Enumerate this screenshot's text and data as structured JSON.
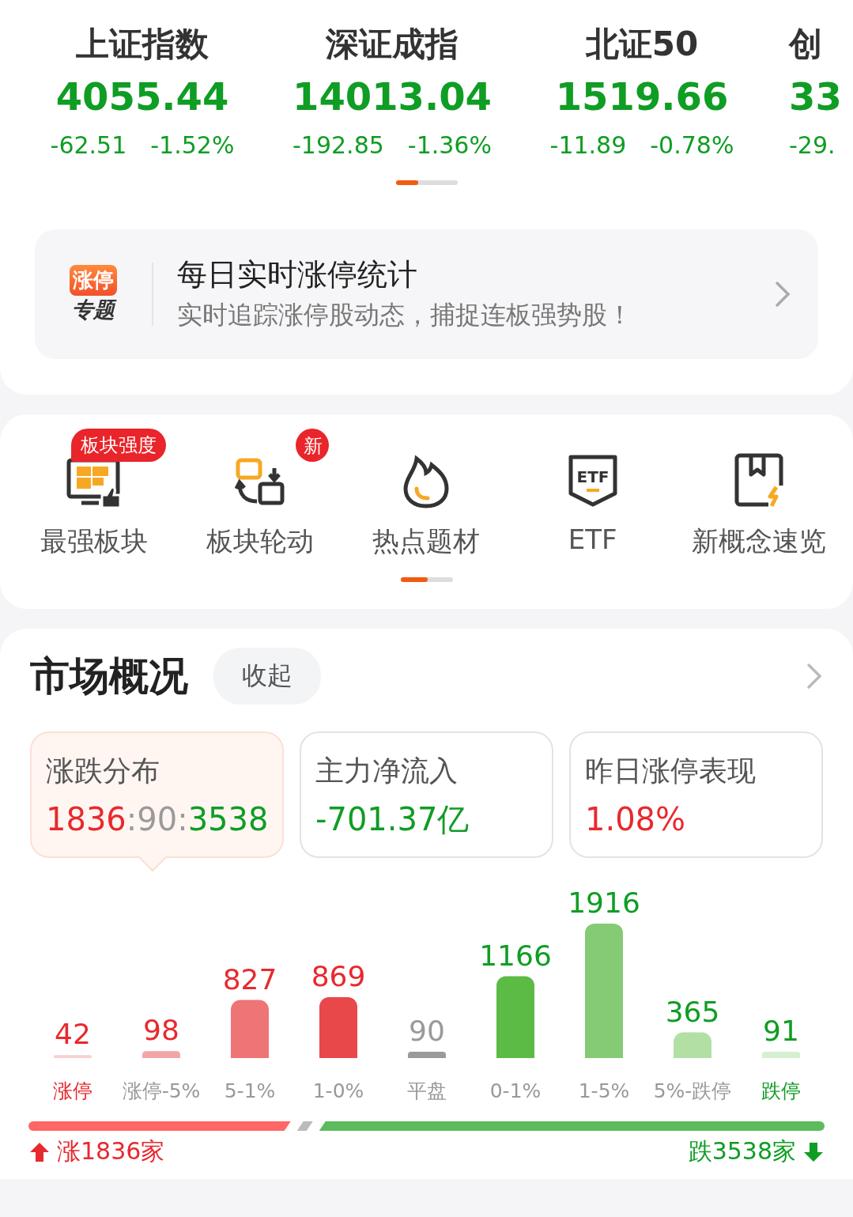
{
  "indices": [
    {
      "name": "上证指数",
      "value": "4055.44",
      "change": "-62.51",
      "percent": "-1.52%"
    },
    {
      "name": "深证成指",
      "value": "14013.04",
      "change": "-192.85",
      "percent": "-1.36%"
    },
    {
      "name": "北证50",
      "value": "1519.66",
      "change": "-11.89",
      "percent": "-0.78%"
    },
    {
      "name": "创",
      "value": "33",
      "change": "-29."
    }
  ],
  "promo": {
    "badge_top": "涨停",
    "badge_bottom": "专题",
    "title": "每日实时涨停统计",
    "subtitle": "实时追踪涨停股动态，捕捉连板强势股！"
  },
  "shortcuts": [
    {
      "label": "最强板块",
      "badge": "板块强度"
    },
    {
      "label": "板块轮动",
      "badge": "新"
    },
    {
      "label": "热点题材"
    },
    {
      "label": "ETF",
      "icon_text": "ETF"
    },
    {
      "label": "新概念速览"
    }
  ],
  "market": {
    "title": "市场概况",
    "collapse_button": "收起",
    "stats": [
      {
        "title": "涨跌分布",
        "selected": true,
        "parts": [
          {
            "text": "1836",
            "color": "#e8292e"
          },
          {
            "text": ":",
            "color": "#9a9a9a"
          },
          {
            "text": "90",
            "color": "#9a9a9a"
          },
          {
            "text": ":",
            "color": "#9a9a9a"
          },
          {
            "text": "3538",
            "color": "#0f9d24"
          }
        ]
      },
      {
        "title": "主力净流入",
        "selected": false,
        "parts": [
          {
            "text": "-701.37亿",
            "color": "#0f9d24"
          }
        ]
      },
      {
        "title": "昨日涨停表现",
        "selected": false,
        "parts": [
          {
            "text": "1.08%",
            "color": "#e8292e"
          }
        ]
      }
    ],
    "chart_data": {
      "type": "bar",
      "categories": [
        "涨停",
        "涨停-5%",
        "5-1%",
        "1-0%",
        "平盘",
        "0-1%",
        "1-5%",
        "5%-跌停",
        "跌停"
      ],
      "values": [
        42,
        98,
        827,
        869,
        90,
        1166,
        1916,
        365,
        91
      ],
      "data_labels": true
    },
    "bars": [
      {
        "color": "#f9d0d1",
        "kind": "limit_up"
      },
      {
        "color": "#f2a5a7",
        "kind": "up"
      },
      {
        "color": "#ee7475",
        "kind": "up"
      },
      {
        "color": "#e8484a",
        "kind": "up"
      },
      {
        "color": "#9a9a9a",
        "kind": "flat"
      },
      {
        "color": "#5cbb44",
        "kind": "down"
      },
      {
        "color": "#84cb74",
        "kind": "down"
      },
      {
        "color": "#b2e0a4",
        "kind": "down"
      },
      {
        "color": "#d6efd0",
        "kind": "limit_down"
      }
    ],
    "up_summary": "涨1836家",
    "down_summary": "跌3538家"
  }
}
